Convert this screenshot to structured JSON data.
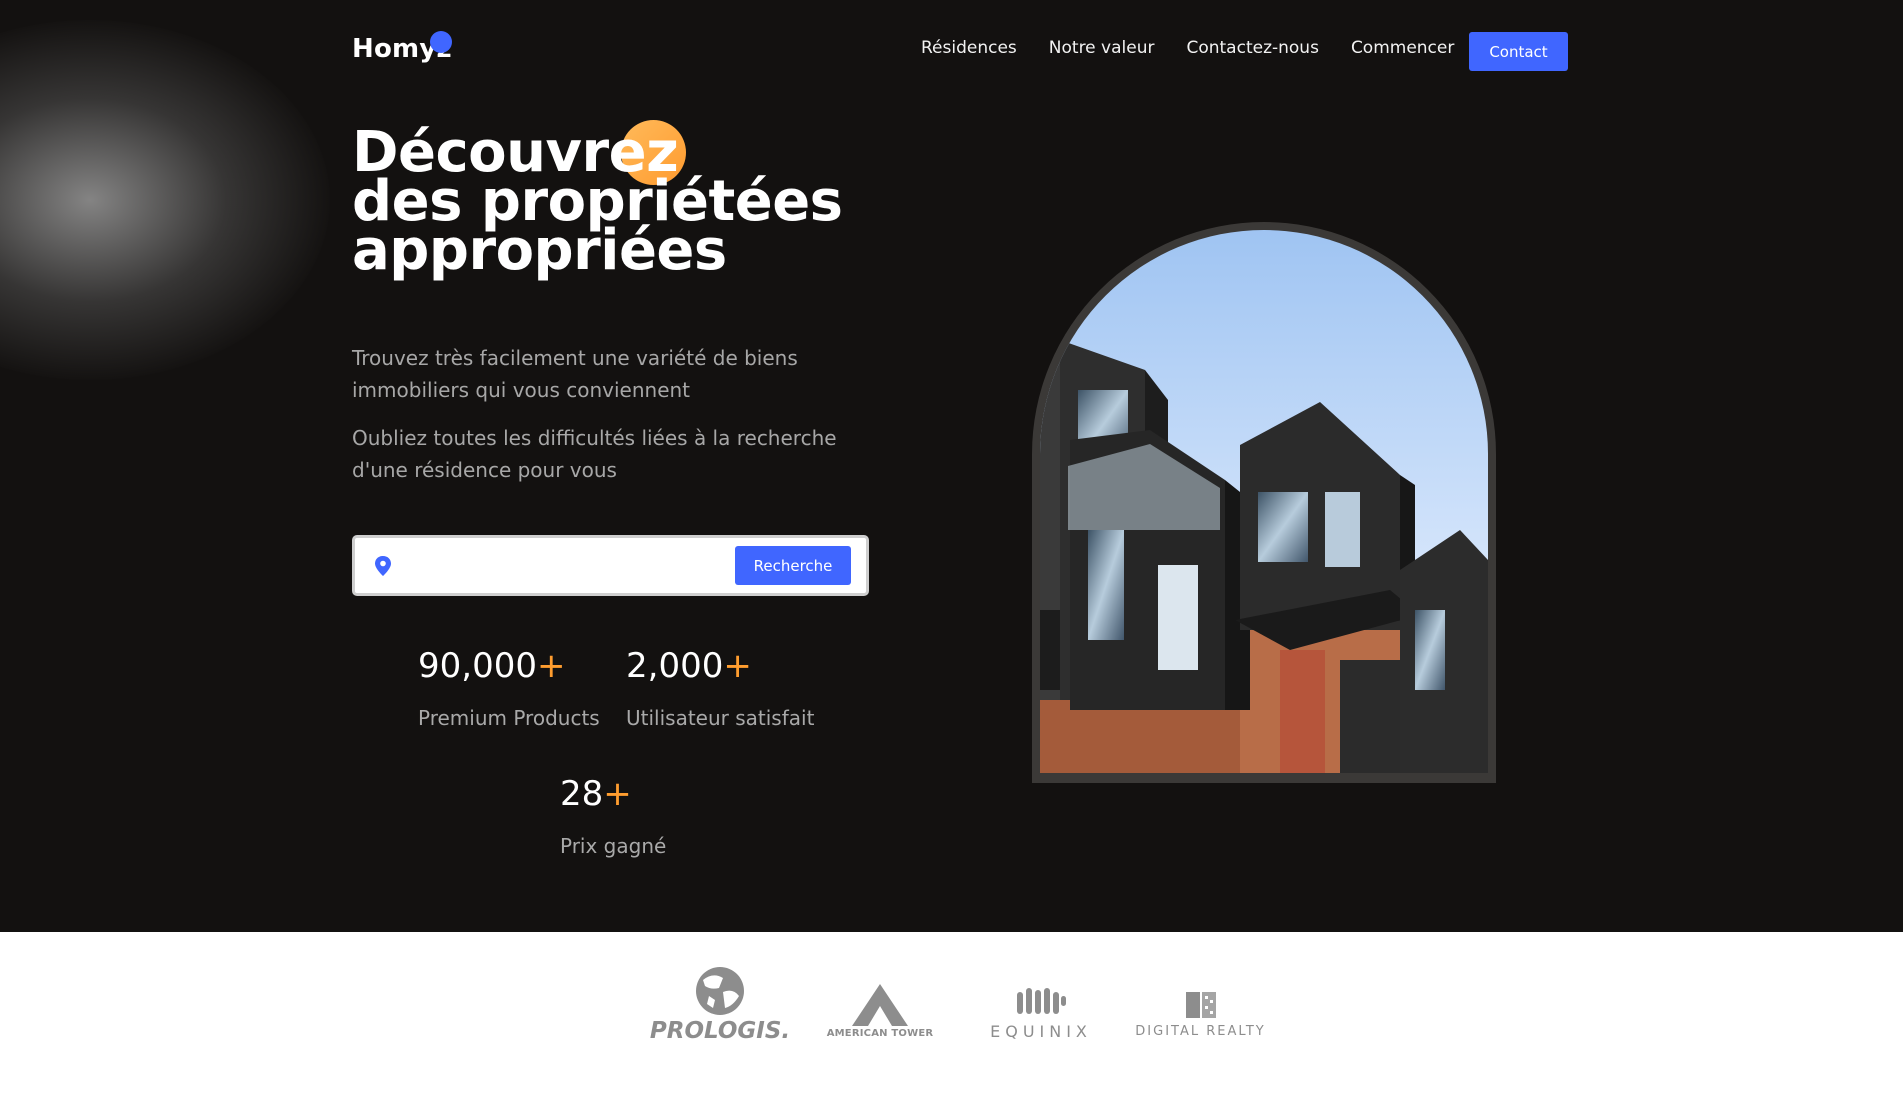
{
  "header": {
    "logo": "Homyz",
    "nav": [
      "Résidences",
      "Notre valeur",
      "Contactez-nous",
      "Commencer"
    ],
    "contact_label": "Contact"
  },
  "hero": {
    "headline": [
      "Découvrez",
      "des propriétées",
      "appropriées"
    ],
    "description_1": "Trouvez très facilement une variété de biens immobiliers qui vous conviennent",
    "description_2": "Oubliez toutes les difficultés liées à la recherche d'une résidence pour vous",
    "search": {
      "value": "",
      "placeholder": "",
      "button_label": "Recherche"
    },
    "stats": [
      {
        "value": "90,000",
        "suffix": "+",
        "label": "Premium Products"
      },
      {
        "value": "2,000",
        "suffix": "+",
        "label": "Utilisateur satisfait"
      },
      {
        "value": "28",
        "suffix": "+",
        "label": "Prix gagné"
      }
    ]
  },
  "partners": [
    "PROLOGIS.",
    "AMERICAN TOWER",
    "EQUINIX",
    "DIGITAL REALTY"
  ],
  "colors": {
    "background": "#131110",
    "accent_blue": "#4066ff",
    "accent_orange": "#ff9d2f",
    "text_muted": "#a7a7a7"
  }
}
